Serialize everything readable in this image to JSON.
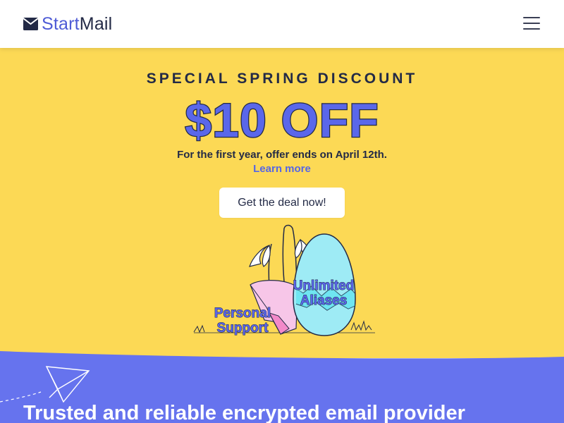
{
  "header": {
    "logo_start": "Start",
    "logo_mail": "Mail",
    "menu_icon": "hamburger-menu-icon"
  },
  "promo": {
    "kicker": "SPECIAL SPRING DISCOUNT",
    "amount": "$10 OFF",
    "subtext": "For the first year, offer ends on April 12th.",
    "link_label": "Learn more",
    "button_label": "Get the deal now!",
    "illustration": {
      "label_top": "Unlimited",
      "label_top2": "Aliases",
      "label_bottom": "Personal",
      "label_bottom2": "Support"
    }
  },
  "section": {
    "headline": "Trusted and reliable encrypted email provider",
    "icon": "paper-plane-icon"
  },
  "colors": {
    "promo_bg": "#fcd955",
    "accent_blue": "#5566e6",
    "section_bg": "#6673ee",
    "dark_text": "#232a46"
  }
}
